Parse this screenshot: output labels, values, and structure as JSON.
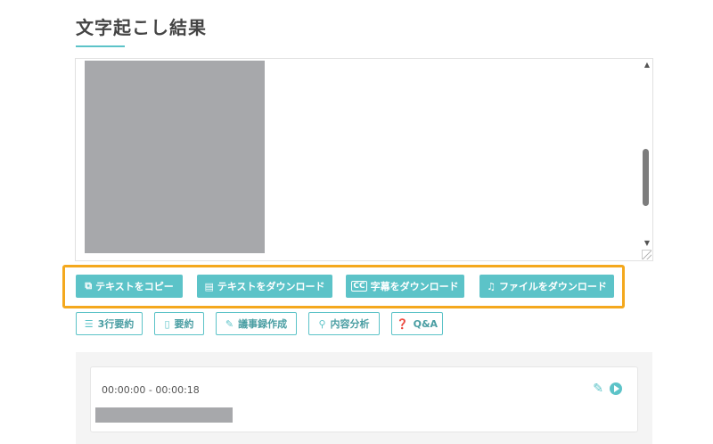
{
  "section": {
    "title": "文字起こし結果"
  },
  "primary_buttons": {
    "copy_text": "テキストをコピー",
    "download_text": "テキストをダウンロード",
    "download_subtitles": "字幕をダウンロード",
    "download_file": "ファイルをダウンロード"
  },
  "secondary_buttons": {
    "summary_3lines": "3行要約",
    "summary": "要約",
    "minutes": "議事録作成",
    "content_analysis": "内容分析",
    "qa": "Q&A"
  },
  "segment": {
    "timestamp": "00:00:00 - 00:00:18"
  },
  "icons": {
    "copy": "copy-icon",
    "file": "file-icon",
    "cc": "cc-icon",
    "music": "music-icon",
    "list": "list-icon",
    "doc": "document-icon",
    "edit": "edit-icon",
    "search": "search-icon",
    "question": "question-icon",
    "pencil": "pencil-icon",
    "play": "play-icon"
  },
  "colors": {
    "accent": "#5cc3c8",
    "highlight": "#f4a81d",
    "redacted": "#a7a8ab"
  }
}
